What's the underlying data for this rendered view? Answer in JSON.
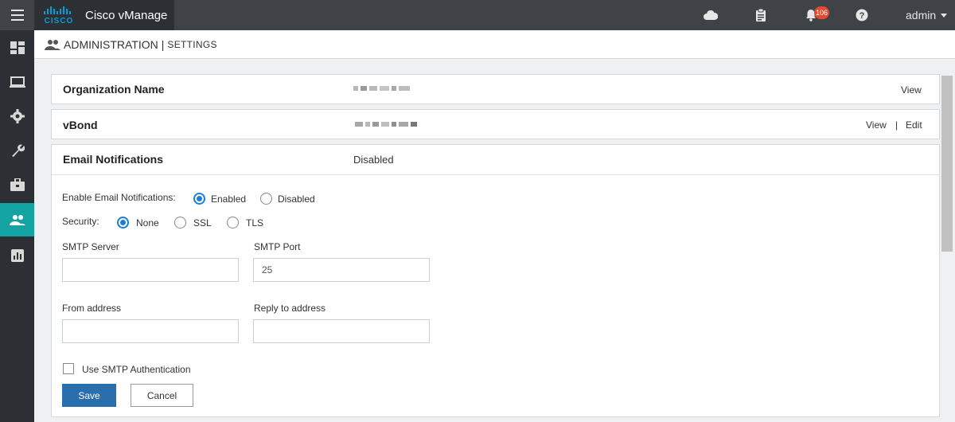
{
  "app": {
    "title": "Cisco vManage",
    "logo_text": "CISCO"
  },
  "topbar": {
    "icons": [
      "cloud-icon",
      "clipboard-icon",
      "bell-icon",
      "help-icon"
    ],
    "notification_count": "106",
    "user": "admin"
  },
  "sidebar": {
    "items": [
      {
        "icon": "dashboard-icon"
      },
      {
        "icon": "monitor-icon"
      },
      {
        "icon": "configuration-gear-icon"
      },
      {
        "icon": "tools-wrench-icon"
      },
      {
        "icon": "maintenance-briefcase-icon"
      },
      {
        "icon": "administration-users-icon",
        "active": true
      },
      {
        "icon": "analytics-icon"
      }
    ],
    "active_color": "#14a3a3"
  },
  "header": {
    "title": "ADMINISTRATION",
    "separator": "|",
    "subtitle": "SETTINGS"
  },
  "settings": [
    {
      "title": "Organization Name",
      "value_redacted": true,
      "actions": [
        "View"
      ]
    },
    {
      "title": "vBond",
      "value_redacted": true,
      "actions": [
        "View",
        "Edit"
      ],
      "action_separator": "|"
    },
    {
      "title": "Email Notifications",
      "value": "Disabled"
    }
  ],
  "email_form": {
    "enable_label": "Enable Email Notifications:",
    "enable_options": [
      "Enabled",
      "Disabled"
    ],
    "enable_selected": "Enabled",
    "security_label": "Security:",
    "security_options": [
      "None",
      "SSL",
      "TLS"
    ],
    "security_selected": "None",
    "smtp_server_label": "SMTP Server",
    "smtp_server_value": "",
    "smtp_port_label": "SMTP Port",
    "smtp_port_value": "25",
    "from_label": "From address",
    "from_value": "",
    "reply_label": "Reply to address",
    "reply_value": "",
    "auth_label": "Use SMTP Authentication",
    "auth_checked": false,
    "save_label": "Save",
    "cancel_label": "Cancel"
  },
  "colors": {
    "topbar": "#3f4246",
    "sidebar": "#2c2f33",
    "primary_button": "#2a6fad",
    "radio_selected": "#1a7fd6",
    "badge": "#e04a2f"
  }
}
